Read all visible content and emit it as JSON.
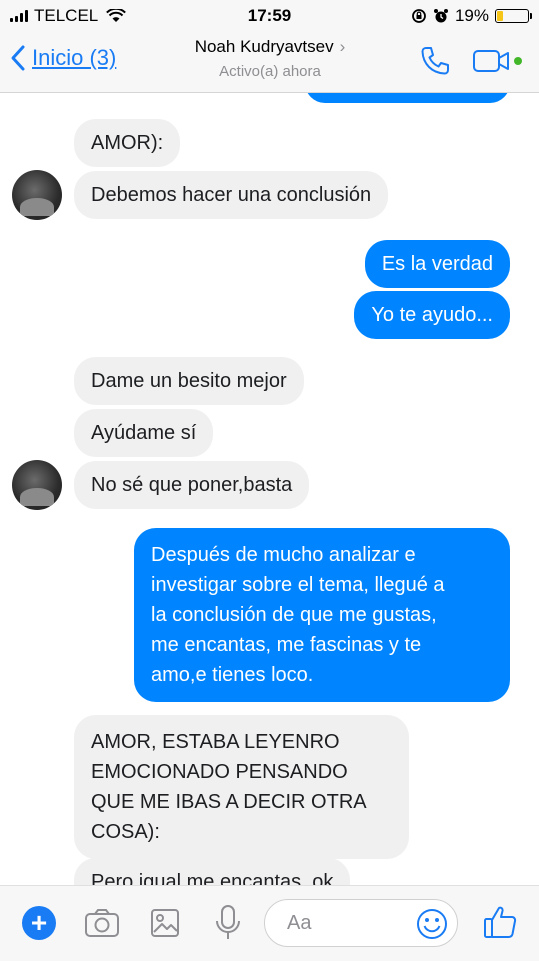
{
  "status_bar": {
    "carrier": "TELCEL",
    "time": "17:59",
    "battery": "19%",
    "battery_level": 0.19
  },
  "header": {
    "back_label": "Inicio (3)",
    "contact_name": "Noah Kudryavtsev",
    "contact_status": "Activo(a) ahora"
  },
  "messages": [
    {
      "from": "them",
      "text": "AMOR):"
    },
    {
      "from": "them",
      "text": "Debemos hacer una conclusión"
    },
    {
      "from": "me",
      "text": "Es la verdad"
    },
    {
      "from": "me",
      "text": "Yo te ayudo..."
    },
    {
      "from": "them",
      "text": "Dame un besito mejor"
    },
    {
      "from": "them",
      "text": "Ayúdame sí"
    },
    {
      "from": "them",
      "text": "No sé que poner,basta"
    },
    {
      "from": "me",
      "lines": [
        "Después de mucho analizar e",
        "investigar sobre el tema, llegué a",
        "la conclusión de que me gustas,",
        "me encantas, me fascinas y te",
        "amo,e tienes loco."
      ]
    },
    {
      "from": "them",
      "lines": [
        "AMOR, ESTABA LEYENRO",
        "EMOCIONADO PENSANDO",
        "QUE ME IBAS A DECIR OTRA",
        "COSA):"
      ]
    },
    {
      "from": "them",
      "text": "Pero igual me encantas, ok"
    }
  ],
  "composer": {
    "placeholder": "Aa"
  },
  "icons": [
    "signal-icon",
    "wifi-icon",
    "lock-rotation-icon",
    "alarm-icon",
    "battery-icon",
    "back-chevron-icon",
    "phone-icon",
    "video-camera-icon",
    "plus-icon",
    "camera-icon",
    "photo-icon",
    "microphone-icon",
    "emoji-icon",
    "thumbs-up-icon"
  ],
  "colors": {
    "accent": "#0084ff",
    "nav_accent": "#1a7cf4",
    "incoming_bubble": "#f1f0f0",
    "online": "#42b72a",
    "battery_fill": "#f5c518"
  }
}
